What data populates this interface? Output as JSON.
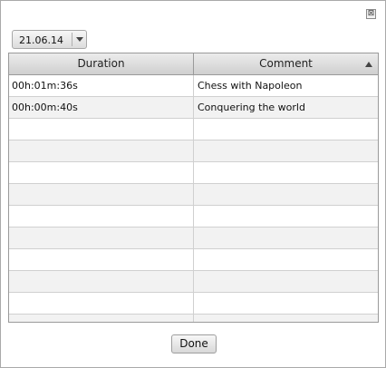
{
  "window": {
    "close_glyph": "⊠"
  },
  "date_selector": {
    "value": "21.06.14"
  },
  "table": {
    "columns": [
      "Duration",
      "Comment"
    ],
    "sort": {
      "column": "Comment",
      "direction": "ascending"
    },
    "rows": [
      {
        "duration": "00h:01m:36s",
        "comment": "Chess with Napoleon"
      },
      {
        "duration": "00h:00m:40s",
        "comment": "Conquering the world"
      },
      {
        "duration": "",
        "comment": ""
      },
      {
        "duration": "",
        "comment": ""
      },
      {
        "duration": "",
        "comment": ""
      },
      {
        "duration": "",
        "comment": ""
      },
      {
        "duration": "",
        "comment": ""
      },
      {
        "duration": "",
        "comment": ""
      },
      {
        "duration": "",
        "comment": ""
      },
      {
        "duration": "",
        "comment": ""
      },
      {
        "duration": "",
        "comment": ""
      },
      {
        "duration": "",
        "comment": ""
      }
    ]
  },
  "footer": {
    "done_label": "Done"
  }
}
